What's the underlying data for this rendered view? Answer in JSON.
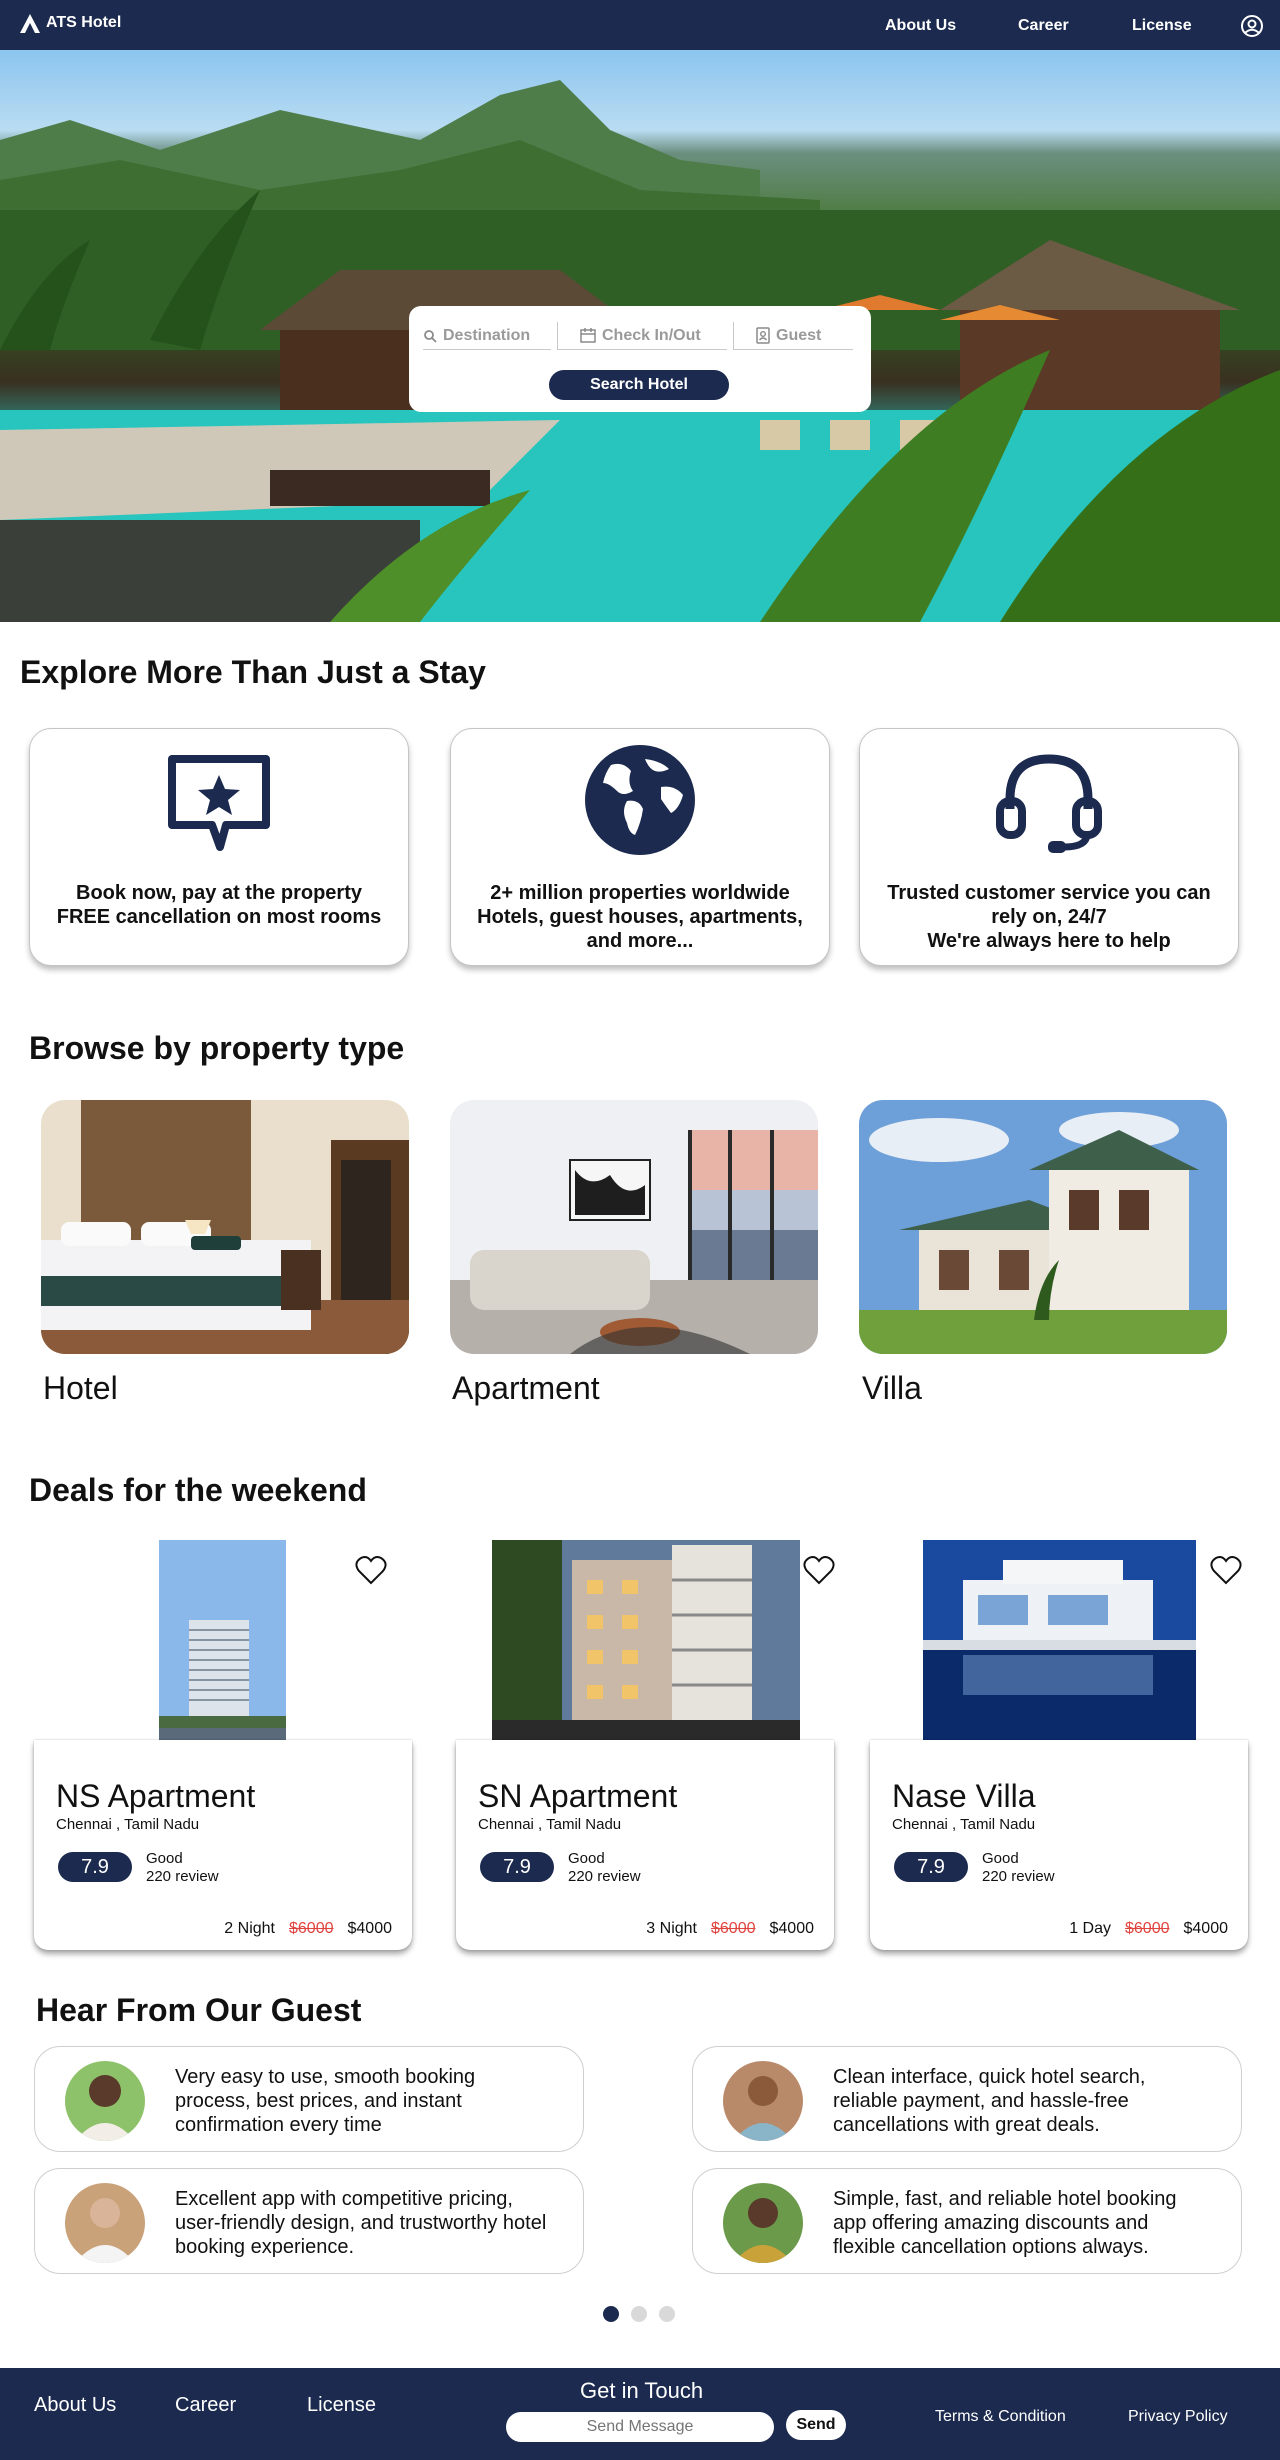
{
  "nav": {
    "brand": "ATS Hotel",
    "links": [
      "About Us",
      "Career",
      "License"
    ]
  },
  "search": {
    "destination_placeholder": "Destination",
    "checkin_placeholder": "Check In/Out",
    "guest_placeholder": "Guest",
    "button_label": "Search Hotel"
  },
  "explore": {
    "title": "Explore More Than Just a Stay",
    "features": [
      {
        "icon": "star-chat-icon",
        "text": "Book now, pay at the property\nFREE cancellation on most rooms"
      },
      {
        "icon": "globe-icon",
        "text": "2+ million properties worldwide\nHotels, guest houses, apartments, and more..."
      },
      {
        "icon": "headset-icon",
        "text": "Trusted customer service you can rely on, 24/7\nWe're always here to help"
      }
    ]
  },
  "browse": {
    "title": "Browse by property type",
    "types": [
      {
        "label": "Hotel"
      },
      {
        "label": "Apartment"
      },
      {
        "label": "Villa"
      }
    ]
  },
  "deals": {
    "title": "Deals for the weekend",
    "items": [
      {
        "name": "NS Apartment",
        "location": "Chennai , Tamil Nadu",
        "score": "7.9",
        "rating": "Good",
        "reviews": "220 review",
        "duration": "2 Night",
        "old_price": "$6000",
        "price": "$4000"
      },
      {
        "name": "SN Apartment",
        "location": "Chennai , Tamil Nadu",
        "score": "7.9",
        "rating": "Good",
        "reviews": "220 review",
        "duration": "3 Night",
        "old_price": "$6000",
        "price": "$4000"
      },
      {
        "name": "Nase Villa",
        "location": "Chennai , Tamil Nadu",
        "score": "7.9",
        "rating": "Good",
        "reviews": "220 review",
        "duration": "1 Day",
        "old_price": "$6000",
        "price": "$4000"
      }
    ]
  },
  "testimonials": {
    "title": "Hear From Our Guest",
    "items": [
      {
        "text": "Very easy to use, smooth booking process, best prices, and instant confirmation every time"
      },
      {
        "text": "Clean interface, quick hotel search, reliable payment, and hassle-free cancellations with great deals."
      },
      {
        "text": "Excellent app with competitive pricing, user-friendly design, and trustworthy hotel booking experience."
      },
      {
        "text": "Simple, fast, and reliable hotel booking app offering amazing discounts and flexible cancellation options always."
      }
    ],
    "active_page": 1,
    "page_count": 3
  },
  "footer": {
    "links": [
      "About Us",
      "Career",
      "License"
    ],
    "contact_title": "Get in Touch",
    "message_placeholder": "Send Message",
    "send_label": "Send",
    "terms": "Terms & Condition",
    "privacy": "Privacy Policy"
  },
  "colors": {
    "primary": "#1b2a4e",
    "strike": "#e0443e"
  }
}
